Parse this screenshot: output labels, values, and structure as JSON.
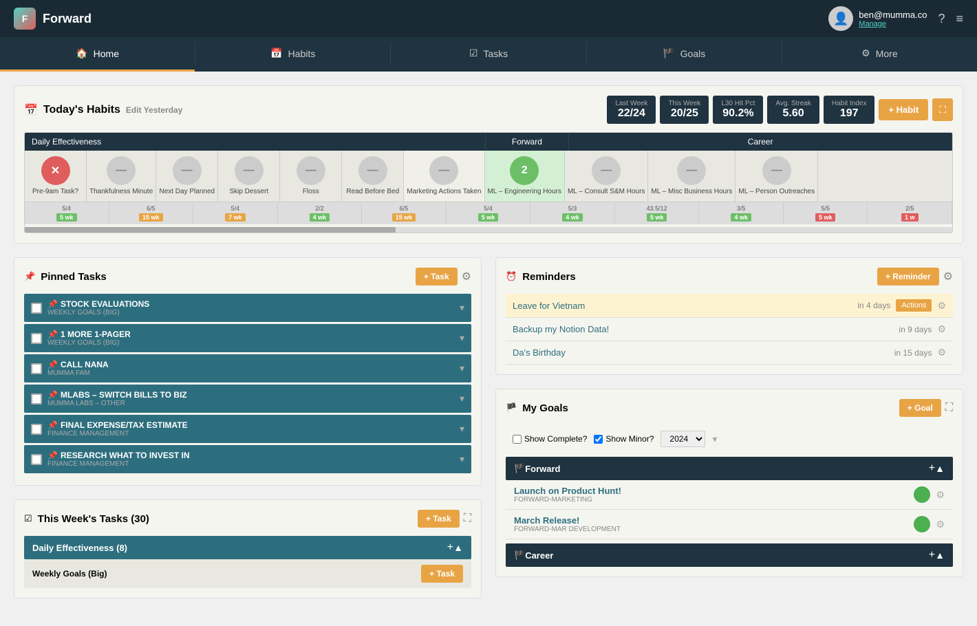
{
  "header": {
    "logo_letter": "F",
    "app_name": "Forward",
    "user_email": "ben@mumma.co",
    "user_manage": "Manage"
  },
  "nav": {
    "items": [
      {
        "id": "home",
        "label": "Home",
        "icon": "🏠",
        "active": true
      },
      {
        "id": "habits",
        "label": "Habits",
        "icon": "📅",
        "active": false
      },
      {
        "id": "tasks",
        "label": "Tasks",
        "icon": "☑",
        "active": false
      },
      {
        "id": "goals",
        "label": "Goals",
        "icon": "🏴",
        "active": false
      },
      {
        "id": "more",
        "label": "More",
        "icon": "⚙",
        "active": false
      }
    ]
  },
  "habits": {
    "title": "Today's Habits",
    "edit_label": "Edit Yesterday",
    "add_btn": "+ Habit",
    "stats": [
      {
        "label": "Last Week",
        "value": "22/24"
      },
      {
        "label": "This Week",
        "value": "20/25"
      },
      {
        "label": "L30 Hit Pct",
        "value": "90.2%"
      },
      {
        "label": "Avg. Streak",
        "value": "5.60"
      },
      {
        "label": "Habit Index",
        "value": "197"
      }
    ],
    "sections": [
      {
        "label": "Daily Effectiveness",
        "span": 6
      },
      {
        "label": "Forward",
        "span": 1
      },
      {
        "label": "Career",
        "span": 5
      }
    ],
    "habit_cols": [
      {
        "label": "Pre-9am Task?",
        "state": "x",
        "streak_type": "red",
        "date": "5/4",
        "badge": "5 wk",
        "badge_color": "green"
      },
      {
        "label": "Thankfulness Minute",
        "state": "skip",
        "streak_type": "orange",
        "date": "6/5",
        "badge": "15 wk",
        "badge_color": "orange"
      },
      {
        "label": "Next Day Planned",
        "state": "skip",
        "streak_type": "green",
        "date": "5/4",
        "badge": "7 wk",
        "badge_color": "orange"
      },
      {
        "label": "Skip Dessert",
        "state": "skip",
        "streak_type": "green",
        "date": "2/2",
        "badge": "4 wk",
        "badge_color": "green"
      },
      {
        "label": "Floss",
        "state": "skip",
        "streak_type": "orange",
        "date": "6/5",
        "badge": "15 wk",
        "badge_color": "orange"
      },
      {
        "label": "Read Before Bed",
        "state": "skip",
        "streak_type": "green",
        "date": "5/4",
        "badge": "5 wk",
        "badge_color": "green"
      },
      {
        "label": "Marketing Actions Taken",
        "state": "skip",
        "streak_type": "green",
        "date": "5/3",
        "badge": "4 wk",
        "badge_color": "green"
      },
      {
        "label": "ML – Engineering Hours",
        "state": "2",
        "streak_type": "green",
        "date": "43.5/12",
        "badge": "5 wk",
        "badge_color": "green"
      },
      {
        "label": "ML – Consult S&M Hours",
        "state": "skip",
        "streak_type": "gray",
        "date": "3/5",
        "badge": "4 wk",
        "badge_color": "green"
      },
      {
        "label": "ML – Misc Business Hours",
        "state": "skip",
        "streak_type": "red",
        "date": "5/5",
        "badge": "5 wk",
        "badge_color": "red"
      },
      {
        "label": "ML – Person Outreaches",
        "state": "skip",
        "streak_type": "red",
        "date": "2/5",
        "badge": "1 w",
        "badge_color": "red"
      }
    ]
  },
  "pinned_tasks": {
    "title": "Pinned Tasks",
    "add_btn": "+ Task",
    "items": [
      {
        "name": "STOCK EVALUATIONS",
        "sub": "WEEKLY GOALS (BIG)",
        "has_gear": true
      },
      {
        "name": "1 MORE 1-PAGER",
        "sub": "WEEKLY GOALS (BIG)",
        "has_gear": true
      },
      {
        "name": "CALL NANA",
        "sub": "MUMMA FAM",
        "has_gear": false
      },
      {
        "name": "MLABS – SWITCH BILLS TO BIZ",
        "sub": "MUMMA LABS – OTHER",
        "has_gear": false
      },
      {
        "name": "FINAL EXPENSE/TAX ESTIMATE",
        "sub": "FINANCE MANAGEMENT",
        "has_gear": false
      },
      {
        "name": "RESEARCH WHAT TO INVEST IN",
        "sub": "FINANCE MANAGEMENT",
        "has_gear": false
      }
    ]
  },
  "reminders": {
    "title": "Reminders",
    "add_btn": "+ Reminder",
    "items": [
      {
        "name": "Leave for Vietnam",
        "days": "in 4 days",
        "highlighted": true,
        "actions": true
      },
      {
        "name": "Backup my Notion Data!",
        "days": "in 9 days",
        "highlighted": false,
        "actions": false
      },
      {
        "name": "Da's Birthday",
        "days": "in 15 days",
        "highlighted": false,
        "actions": false
      }
    ]
  },
  "goals": {
    "title": "My Goals",
    "add_btn": "+ Goal",
    "show_complete_label": "Show Complete?",
    "show_minor_label": "Show Minor?",
    "year": "2024",
    "sections": [
      {
        "name": "Forward",
        "items": [
          {
            "name": "Launch on Product Hunt!",
            "sub": "FORWARD-MARKETING",
            "color": "green"
          },
          {
            "name": "March Release!",
            "sub": "FORWARD-MAR DEVELOPMENT",
            "color": "green"
          }
        ]
      },
      {
        "name": "Career",
        "items": []
      }
    ]
  },
  "week_tasks": {
    "title": "This Week's Tasks (30)",
    "add_btn": "+ Task",
    "sections": [
      {
        "name": "Daily Effectiveness (8)",
        "sub_sections": [
          {
            "name": "Weekly Goals (Big)",
            "task_btn": "+ Task"
          }
        ]
      }
    ]
  }
}
